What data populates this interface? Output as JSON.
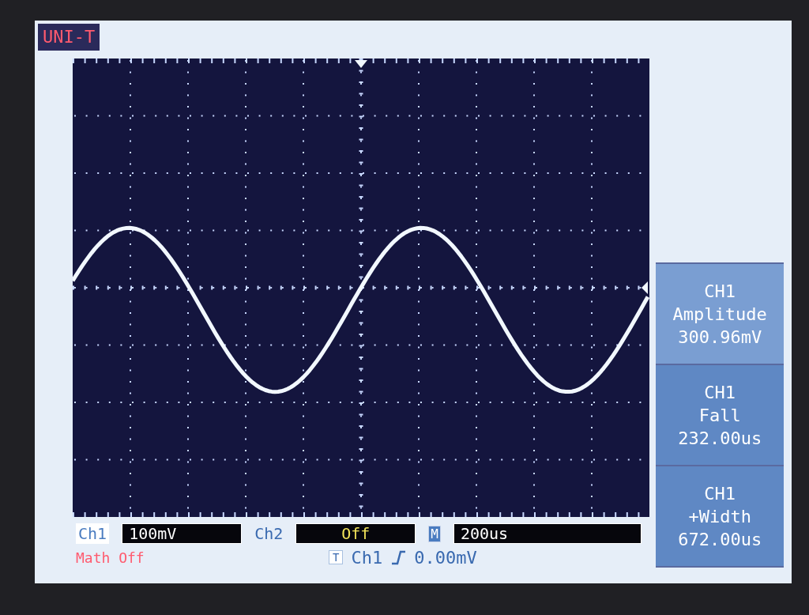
{
  "brand": "UNI-T",
  "measurements": [
    {
      "channel": "CH1",
      "name": "Amplitude",
      "value": "300.96mV"
    },
    {
      "channel": "CH1",
      "name": "Fall",
      "value": "232.00us"
    },
    {
      "channel": "CH1",
      "name": "+Width",
      "value": "672.00us"
    }
  ],
  "status_bar": {
    "ch1_label": "Ch1",
    "ch1_scale": "100mV",
    "ch2_label": "Ch2",
    "ch2_scale": "Off",
    "timebase_label": "M",
    "timebase": "200us",
    "math": "Math Off",
    "trigger_label": "T",
    "trigger_source": "Ch1",
    "trigger_level": "0.00mV"
  }
}
